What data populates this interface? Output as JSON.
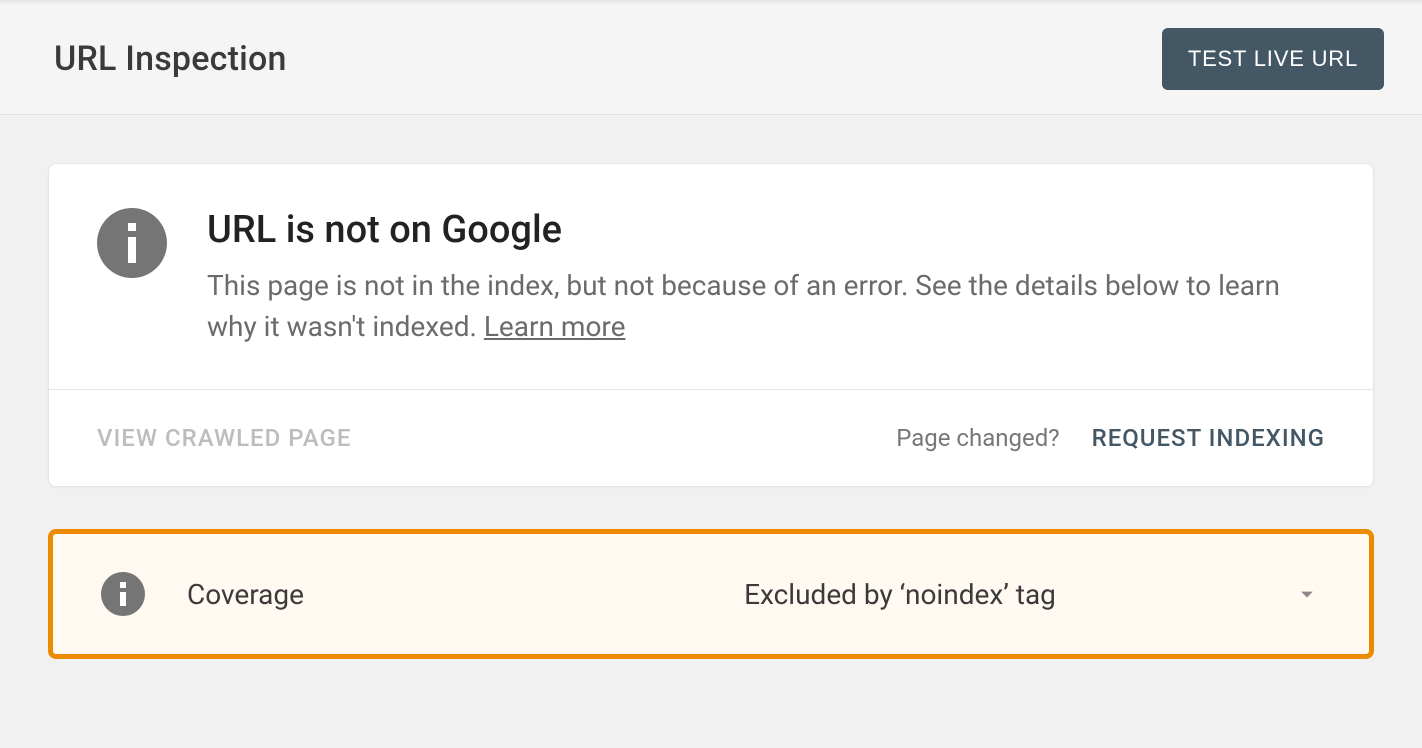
{
  "header": {
    "title": "URL Inspection",
    "test_button": "TEST LIVE URL"
  },
  "status": {
    "heading": "URL is not on Google",
    "description": "This page is not in the index, but not because of an error. See the details below to learn why it wasn't indexed. ",
    "learn_more": "Learn more",
    "view_crawled": "VIEW CRAWLED PAGE",
    "page_changed": "Page changed?",
    "request_indexing": "REQUEST INDEXING"
  },
  "coverage": {
    "label": "Coverage",
    "value": "Excluded by ‘noindex’ tag"
  }
}
